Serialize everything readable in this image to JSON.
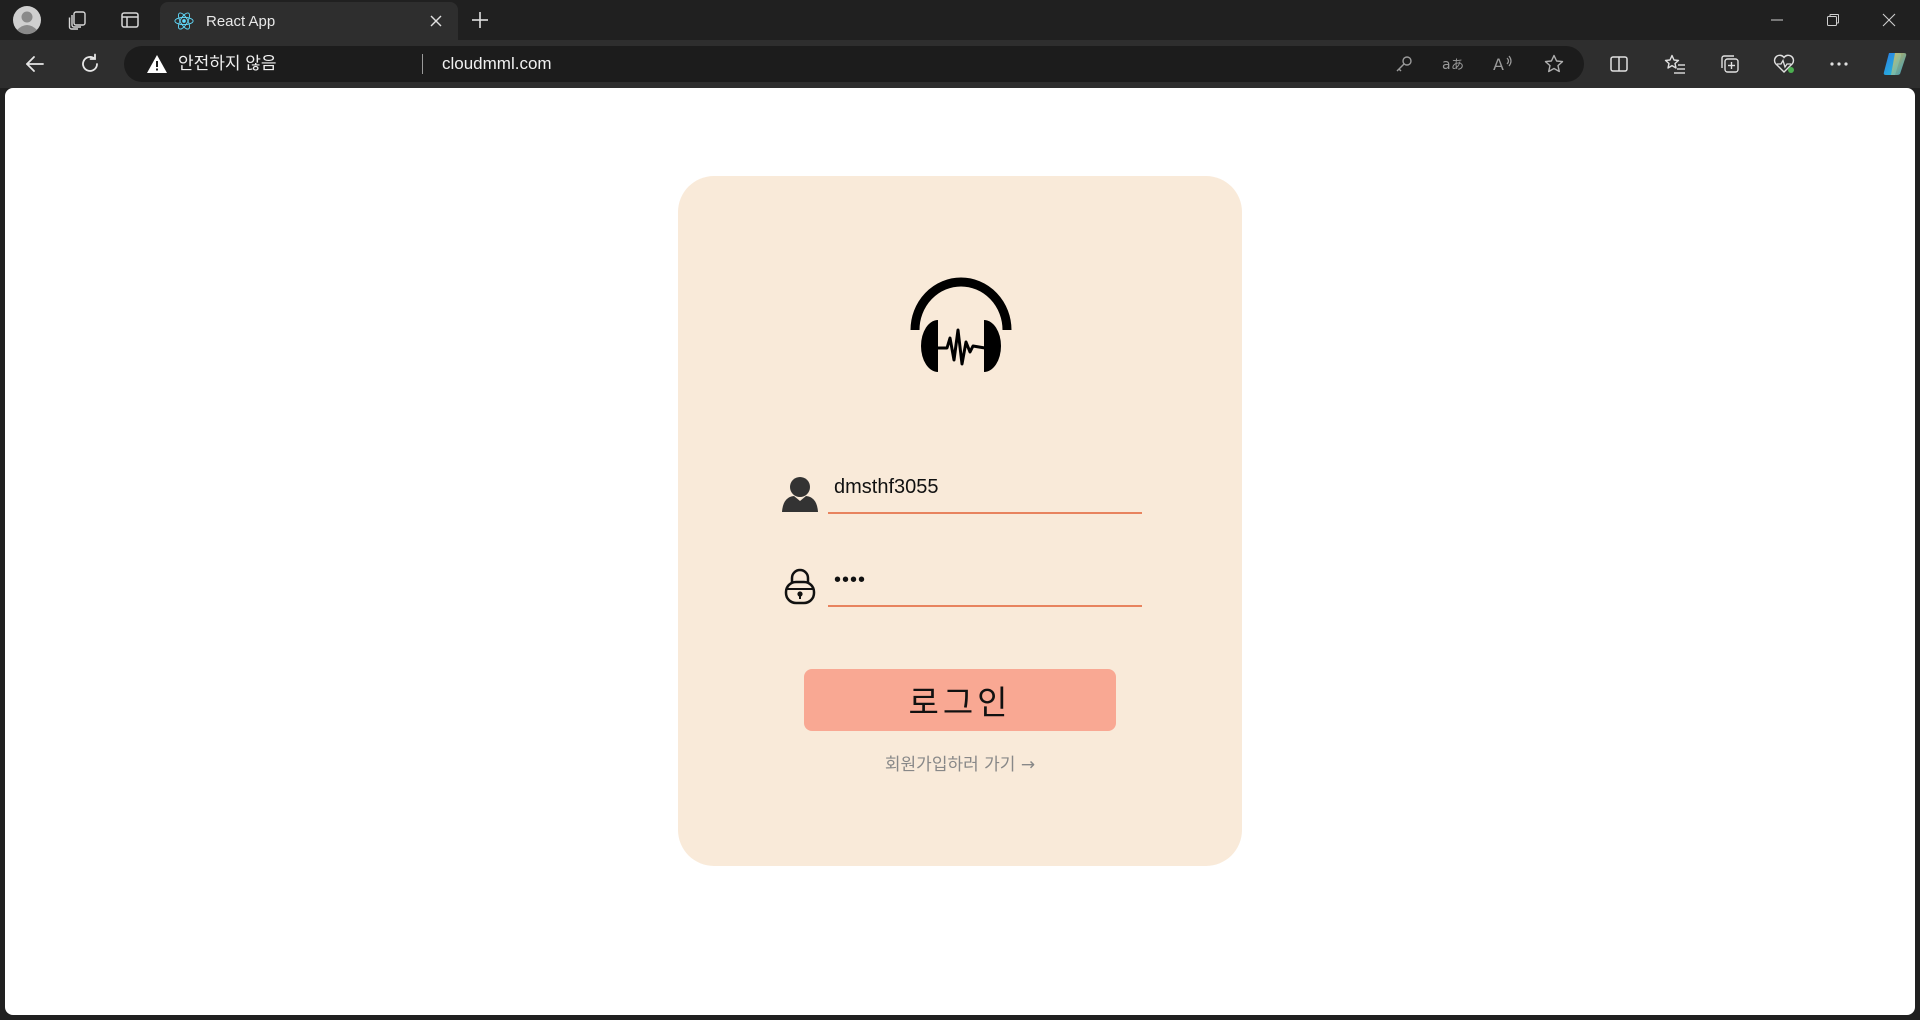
{
  "browser": {
    "tab": {
      "title": "React App"
    },
    "address_bar": {
      "security_label": "안전하지 않음",
      "url": "cloudmml.com"
    },
    "toolbar_icons": [
      "back-icon",
      "refresh-icon",
      "key-icon",
      "translate-icon",
      "read-aloud-icon",
      "favorite-star-icon",
      "split-screen-icon",
      "favorites-icon",
      "collections-icon",
      "performance-icon",
      "more-icon",
      "copilot-icon"
    ]
  },
  "login": {
    "username_value": "dmsthf3055",
    "password_masked": "••••",
    "login_button_label": "로그인",
    "signup_link_text": "회원가입하러 가기 →"
  },
  "colors": {
    "card_background": "#f9ead9",
    "button_background": "#f9a893",
    "underline": "#e8835e",
    "link_text": "#888888"
  }
}
